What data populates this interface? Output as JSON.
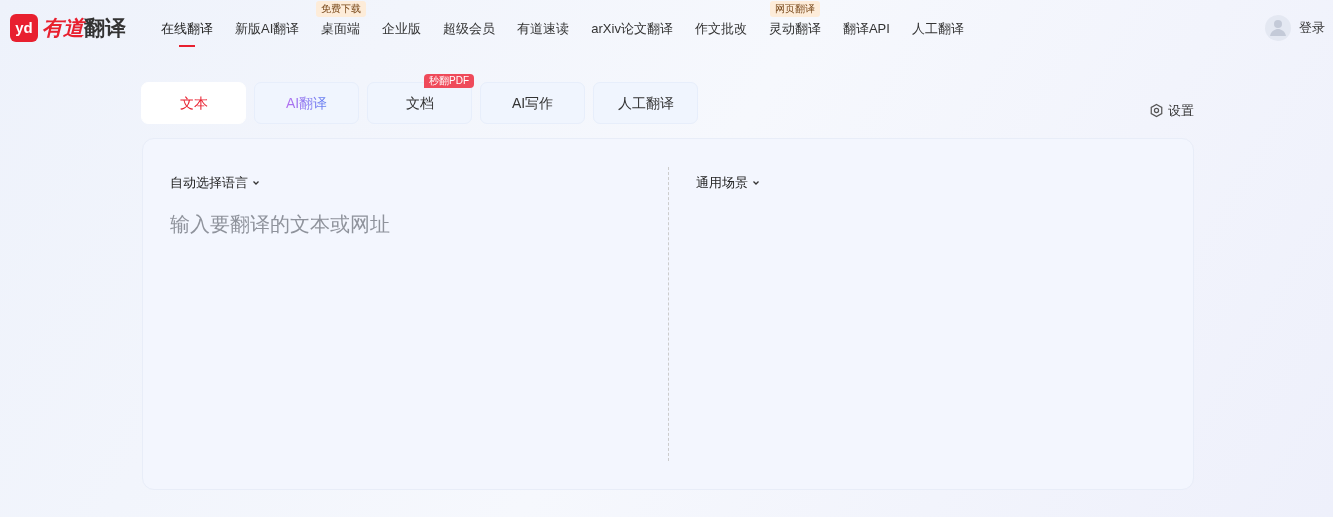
{
  "logo": {
    "mark": "yd",
    "brand": "有道",
    "product": "翻译"
  },
  "nav": [
    {
      "label": "在线翻译",
      "selected": true
    },
    {
      "label": "新版AI翻译",
      "selected": false
    },
    {
      "label": "桌面端",
      "selected": false,
      "badge": "免费下载"
    },
    {
      "label": "企业版",
      "selected": false
    },
    {
      "label": "超级会员",
      "selected": false
    },
    {
      "label": "有道速读",
      "selected": false
    },
    {
      "label": "arXiv论文翻译",
      "selected": false
    },
    {
      "label": "作文批改",
      "selected": false
    },
    {
      "label": "灵动翻译",
      "selected": false,
      "badge": "网页翻译"
    },
    {
      "label": "翻译API",
      "selected": false
    },
    {
      "label": "人工翻译",
      "selected": false
    }
  ],
  "login": "登录",
  "tabs": [
    {
      "label": "文本",
      "selected": true,
      "kind": "plain"
    },
    {
      "label": "AI翻译",
      "selected": false,
      "kind": "gradient"
    },
    {
      "label": "文档",
      "selected": false,
      "kind": "plain",
      "badge": "秒翻PDF"
    },
    {
      "label": "AI写作",
      "selected": false,
      "kind": "plain"
    },
    {
      "label": "人工翻译",
      "selected": false,
      "kind": "plain"
    }
  ],
  "settings": "设置",
  "source": {
    "language": "自动选择语言",
    "placeholder": "输入要翻译的文本或网址"
  },
  "target": {
    "scene": "通用场景"
  }
}
